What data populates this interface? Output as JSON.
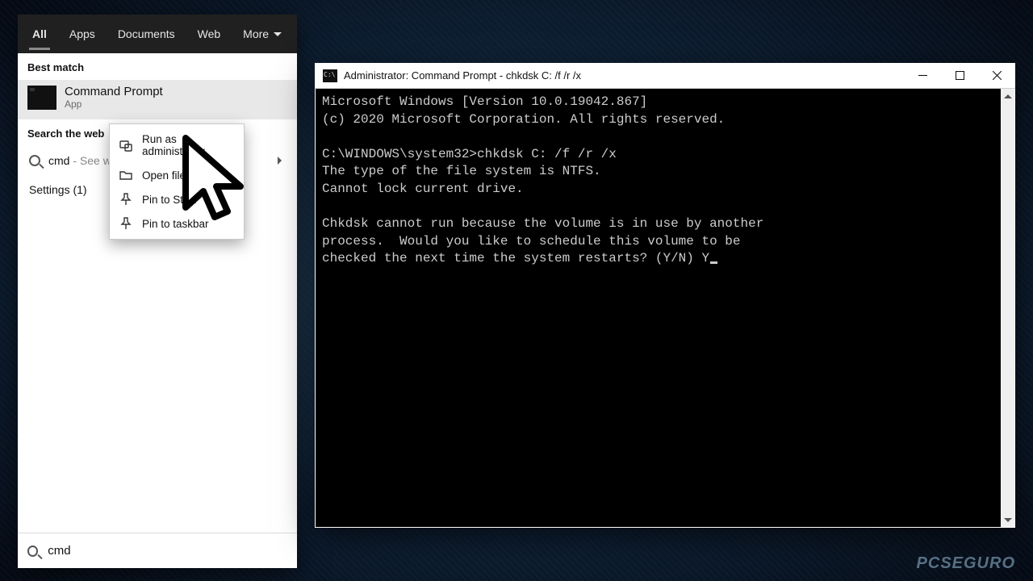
{
  "start": {
    "tabs": [
      "All",
      "Apps",
      "Documents",
      "Web",
      "More"
    ],
    "active_tab": 0,
    "best_match_label": "Best match",
    "best_match": {
      "title": "Command Prompt",
      "subtitle": "App"
    },
    "search_web_label": "Search the web",
    "web_item_prefix": "cmd",
    "web_item_hint": " - See w",
    "settings_label": "Settings (1)",
    "search_value": "cmd"
  },
  "context_menu": {
    "items": [
      {
        "label": "Run as administrator",
        "icon": "admin"
      },
      {
        "label": "Open file location",
        "icon": "folder"
      },
      {
        "label": "Pin to Start",
        "icon": "pin"
      },
      {
        "label": "Pin to taskbar",
        "icon": "pin"
      }
    ]
  },
  "cmd": {
    "title": "Administrator: Command Prompt - chkdsk  C: /f /r /x",
    "lines": [
      "Microsoft Windows [Version 10.0.19042.867]",
      "(c) 2020 Microsoft Corporation. All rights reserved.",
      "",
      "C:\\WINDOWS\\system32>chkdsk C: /f /r /x",
      "The type of the file system is NTFS.",
      "Cannot lock current drive.",
      "",
      "Chkdsk cannot run because the volume is in use by another",
      "process.  Would you like to schedule this volume to be",
      "checked the next time the system restarts? (Y/N) Y"
    ]
  },
  "watermark": "PCSEGURO"
}
